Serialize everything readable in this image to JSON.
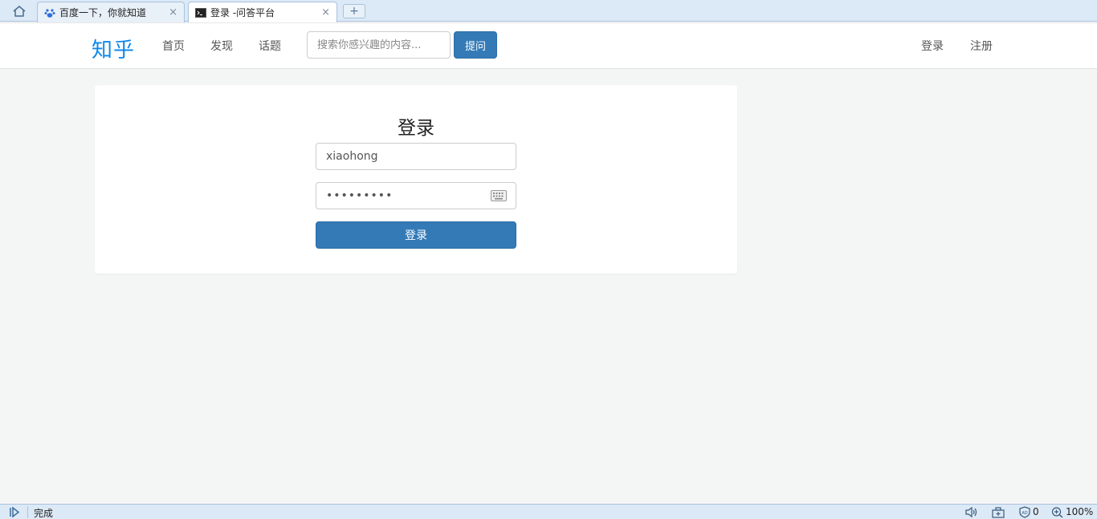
{
  "browser": {
    "tabs": [
      {
        "title": "百度一下，你就知道",
        "close": "×",
        "icon": "baidu-paw-icon"
      },
      {
        "title": "登录 -问答平台",
        "close": "×",
        "icon": "terminal-icon"
      }
    ],
    "new_tab_label": "+"
  },
  "navbar": {
    "brand": "知乎",
    "links": [
      "首页",
      "发现",
      "话题"
    ],
    "search_placeholder": "搜索你感兴趣的内容...",
    "ask_label": "提问",
    "login_label": "登录",
    "register_label": "注册"
  },
  "login": {
    "title": "登录",
    "username_value": "xiaohong",
    "password_value": "•••••••••",
    "submit_label": "登录"
  },
  "statusbar": {
    "status_text": "完成",
    "adblock_count": "0",
    "zoom": "100%"
  },
  "colors": {
    "brand": "#0f88eb",
    "primary_button": "#337ab7",
    "page_background": "#f4f5f5"
  }
}
